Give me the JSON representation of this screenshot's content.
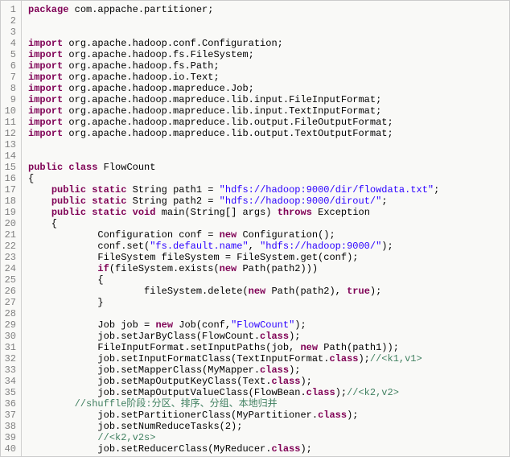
{
  "lines": [
    {
      "n": 1,
      "t": [
        {
          "c": "kw",
          "v": "package"
        },
        {
          "c": "",
          "v": " com.appache.partitioner;"
        }
      ]
    },
    {
      "n": 2,
      "t": [
        {
          "c": "",
          "v": ""
        }
      ]
    },
    {
      "n": 3,
      "t": [
        {
          "c": "",
          "v": ""
        }
      ]
    },
    {
      "n": 4,
      "t": [
        {
          "c": "kw",
          "v": "import"
        },
        {
          "c": "",
          "v": " org.apache.hadoop.conf.Configuration;"
        }
      ]
    },
    {
      "n": 5,
      "t": [
        {
          "c": "kw",
          "v": "import"
        },
        {
          "c": "",
          "v": " org.apache.hadoop.fs.FileSystem;"
        }
      ]
    },
    {
      "n": 6,
      "t": [
        {
          "c": "kw",
          "v": "import"
        },
        {
          "c": "",
          "v": " org.apache.hadoop.fs.Path;"
        }
      ]
    },
    {
      "n": 7,
      "t": [
        {
          "c": "kw",
          "v": "import"
        },
        {
          "c": "",
          "v": " org.apache.hadoop.io.Text;"
        }
      ]
    },
    {
      "n": 8,
      "t": [
        {
          "c": "kw",
          "v": "import"
        },
        {
          "c": "",
          "v": " org.apache.hadoop.mapreduce.Job;"
        }
      ]
    },
    {
      "n": 9,
      "t": [
        {
          "c": "kw",
          "v": "import"
        },
        {
          "c": "",
          "v": " org.apache.hadoop.mapreduce.lib.input.FileInputFormat;"
        }
      ]
    },
    {
      "n": 10,
      "t": [
        {
          "c": "kw",
          "v": "import"
        },
        {
          "c": "",
          "v": " org.apache.hadoop.mapreduce.lib.input.TextInputFormat;"
        }
      ]
    },
    {
      "n": 11,
      "t": [
        {
          "c": "kw",
          "v": "import"
        },
        {
          "c": "",
          "v": " org.apache.hadoop.mapreduce.lib.output.FileOutputFormat;"
        }
      ]
    },
    {
      "n": 12,
      "t": [
        {
          "c": "kw",
          "v": "import"
        },
        {
          "c": "",
          "v": " org.apache.hadoop.mapreduce.lib.output.TextOutputFormat;"
        }
      ]
    },
    {
      "n": 13,
      "t": [
        {
          "c": "",
          "v": ""
        }
      ]
    },
    {
      "n": 14,
      "t": [
        {
          "c": "",
          "v": ""
        }
      ]
    },
    {
      "n": 15,
      "t": [
        {
          "c": "kw",
          "v": "public"
        },
        {
          "c": "",
          "v": " "
        },
        {
          "c": "kw",
          "v": "class"
        },
        {
          "c": "",
          "v": " FlowCount"
        }
      ]
    },
    {
      "n": 16,
      "t": [
        {
          "c": "",
          "v": "{"
        }
      ]
    },
    {
      "n": 17,
      "t": [
        {
          "c": "",
          "v": "    "
        },
        {
          "c": "kw",
          "v": "public"
        },
        {
          "c": "",
          "v": " "
        },
        {
          "c": "kw",
          "v": "static"
        },
        {
          "c": "",
          "v": " String path1 = "
        },
        {
          "c": "str",
          "v": "\"hdfs://hadoop:9000/dir/flowdata.txt\""
        },
        {
          "c": "",
          "v": ";"
        }
      ]
    },
    {
      "n": 18,
      "t": [
        {
          "c": "",
          "v": "    "
        },
        {
          "c": "kw",
          "v": "public"
        },
        {
          "c": "",
          "v": " "
        },
        {
          "c": "kw",
          "v": "static"
        },
        {
          "c": "",
          "v": " String path2 = "
        },
        {
          "c": "str",
          "v": "\"hdfs://hadoop:9000/dirout/\""
        },
        {
          "c": "",
          "v": ";"
        }
      ]
    },
    {
      "n": 19,
      "t": [
        {
          "c": "",
          "v": "    "
        },
        {
          "c": "kw",
          "v": "public"
        },
        {
          "c": "",
          "v": " "
        },
        {
          "c": "kw",
          "v": "static"
        },
        {
          "c": "",
          "v": " "
        },
        {
          "c": "kw",
          "v": "void"
        },
        {
          "c": "",
          "v": " main(String[] args) "
        },
        {
          "c": "kw",
          "v": "throws"
        },
        {
          "c": "",
          "v": " Exception"
        }
      ]
    },
    {
      "n": 20,
      "t": [
        {
          "c": "",
          "v": "    {"
        }
      ]
    },
    {
      "n": 21,
      "t": [
        {
          "c": "",
          "v": "            Configuration conf = "
        },
        {
          "c": "kw",
          "v": "new"
        },
        {
          "c": "",
          "v": " Configuration();"
        }
      ]
    },
    {
      "n": 22,
      "t": [
        {
          "c": "",
          "v": "            conf.set("
        },
        {
          "c": "str",
          "v": "\"fs.default.name\""
        },
        {
          "c": "",
          "v": ", "
        },
        {
          "c": "str",
          "v": "\"hdfs://hadoop:9000/\""
        },
        {
          "c": "",
          "v": ");"
        }
      ]
    },
    {
      "n": 23,
      "t": [
        {
          "c": "",
          "v": "            FileSystem fileSystem = FileSystem.get(conf);"
        }
      ]
    },
    {
      "n": 24,
      "t": [
        {
          "c": "",
          "v": "            "
        },
        {
          "c": "kw",
          "v": "if"
        },
        {
          "c": "",
          "v": "(fileSystem.exists("
        },
        {
          "c": "kw",
          "v": "new"
        },
        {
          "c": "",
          "v": " Path(path2)))"
        }
      ]
    },
    {
      "n": 25,
      "t": [
        {
          "c": "",
          "v": "            {"
        }
      ]
    },
    {
      "n": 26,
      "t": [
        {
          "c": "",
          "v": "                    fileSystem.delete("
        },
        {
          "c": "kw",
          "v": "new"
        },
        {
          "c": "",
          "v": " Path(path2), "
        },
        {
          "c": "kw",
          "v": "true"
        },
        {
          "c": "",
          "v": ");"
        }
      ]
    },
    {
      "n": 27,
      "t": [
        {
          "c": "",
          "v": "            }"
        }
      ]
    },
    {
      "n": 28,
      "t": [
        {
          "c": "",
          "v": ""
        }
      ]
    },
    {
      "n": 29,
      "t": [
        {
          "c": "",
          "v": "            Job job = "
        },
        {
          "c": "kw",
          "v": "new"
        },
        {
          "c": "",
          "v": " Job(conf,"
        },
        {
          "c": "str",
          "v": "\"FlowCount\""
        },
        {
          "c": "",
          "v": ");"
        }
      ]
    },
    {
      "n": 30,
      "t": [
        {
          "c": "",
          "v": "            job.setJarByClass(FlowCount."
        },
        {
          "c": "kw",
          "v": "class"
        },
        {
          "c": "",
          "v": ");    "
        }
      ]
    },
    {
      "n": 31,
      "t": [
        {
          "c": "",
          "v": "            FileInputFormat.setInputPaths(job, "
        },
        {
          "c": "kw",
          "v": "new"
        },
        {
          "c": "",
          "v": " Path(path1));"
        }
      ]
    },
    {
      "n": 32,
      "t": [
        {
          "c": "",
          "v": "            job.setInputFormatClass(TextInputFormat."
        },
        {
          "c": "kw",
          "v": "class"
        },
        {
          "c": "",
          "v": ");"
        },
        {
          "c": "com",
          "v": "//<k1,v1>"
        }
      ]
    },
    {
      "n": 33,
      "t": [
        {
          "c": "",
          "v": "            job.setMapperClass(MyMapper."
        },
        {
          "c": "kw",
          "v": "class"
        },
        {
          "c": "",
          "v": ");"
        }
      ]
    },
    {
      "n": 34,
      "t": [
        {
          "c": "",
          "v": "            job.setMapOutputKeyClass(Text."
        },
        {
          "c": "kw",
          "v": "class"
        },
        {
          "c": "",
          "v": ");"
        }
      ]
    },
    {
      "n": 35,
      "t": [
        {
          "c": "",
          "v": "            job.setMapOutputValueClass(FlowBean."
        },
        {
          "c": "kw",
          "v": "class"
        },
        {
          "c": "",
          "v": ");"
        },
        {
          "c": "com",
          "v": "//<k2,v2>"
        }
      ]
    },
    {
      "n": 36,
      "t": [
        {
          "c": "",
          "v": "        "
        },
        {
          "c": "com",
          "v": "//shuffle阶段:分区、排序、分组、本地归并"
        }
      ]
    },
    {
      "n": 37,
      "t": [
        {
          "c": "",
          "v": "            job.setPartitionerClass(MyPartitioner."
        },
        {
          "c": "kw",
          "v": "class"
        },
        {
          "c": "",
          "v": ");"
        }
      ]
    },
    {
      "n": 38,
      "t": [
        {
          "c": "",
          "v": "            job.setNumReduceTasks(2);"
        }
      ]
    },
    {
      "n": 39,
      "t": [
        {
          "c": "",
          "v": "            "
        },
        {
          "c": "com",
          "v": "//<k2,v2s>"
        }
      ]
    },
    {
      "n": 40,
      "t": [
        {
          "c": "",
          "v": "            job.setReducerClass(MyReducer."
        },
        {
          "c": "kw",
          "v": "class"
        },
        {
          "c": "",
          "v": ");"
        }
      ]
    }
  ]
}
